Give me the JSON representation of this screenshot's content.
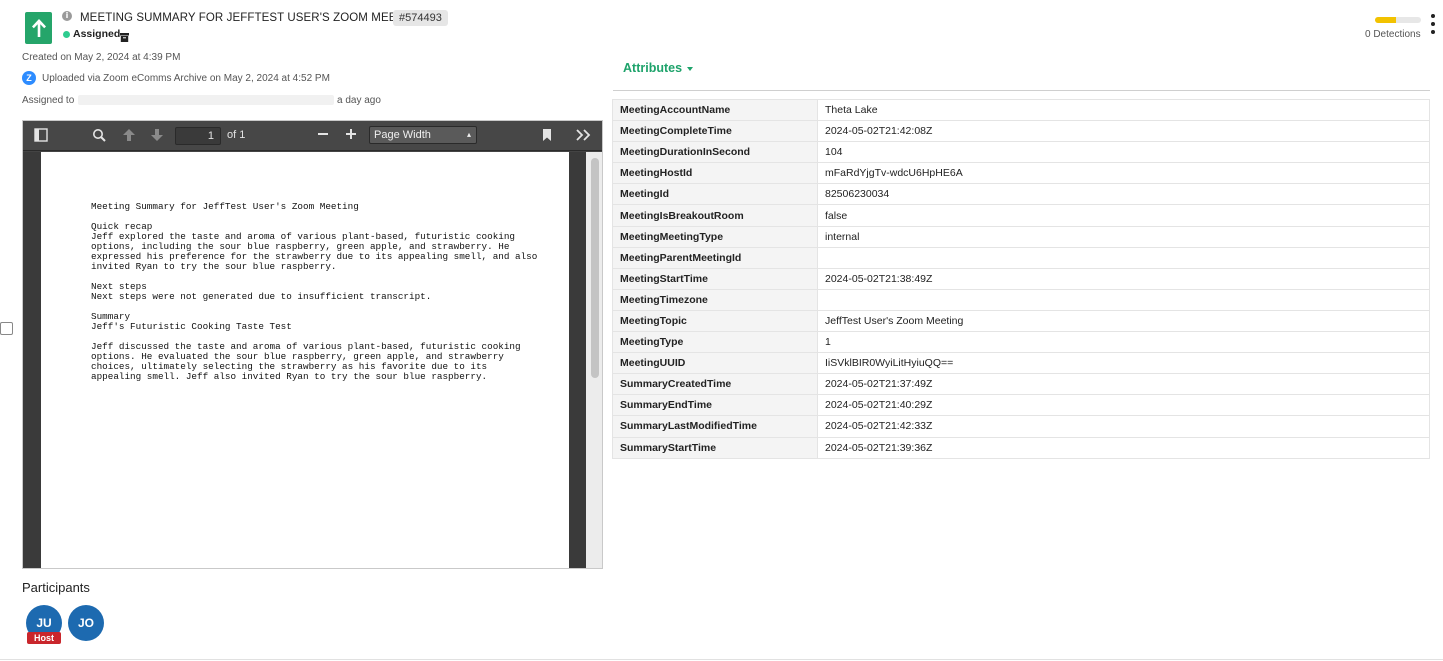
{
  "header": {
    "title": "MEETING SUMMARY FOR JEFFTEST USER'S ZOOM MEETING",
    "id": "#574493",
    "status": "Assigned",
    "accent_color": "#25a56a"
  },
  "meta": {
    "created": "Created on May 2, 2024 at 4:39 PM",
    "uploaded": "Uploaded via Zoom eComms Archive on May 2, 2024 at 4:52 PM",
    "assigned_prefix": "Assigned to",
    "assigned_suffix": "a day ago",
    "zoom_logo_letter": "Z"
  },
  "detections": {
    "label": "0 Detections",
    "level_fraction": 0.45
  },
  "viewer": {
    "page_number": "1",
    "page_of": "of 1",
    "zoom_value": "Page Width",
    "document_text": "Meeting Summary for JeffTest User's Zoom Meeting\n\nQuick recap\nJeff explored the taste and aroma of various plant-based, futuristic cooking\noptions, including the sour blue raspberry, green apple, and strawberry. He\nexpressed his preference for the strawberry due to its appealing smell, and also\ninvited Ryan to try the sour blue raspberry.\n\nNext steps\nNext steps were not generated due to insufficient transcript.\n\nSummary\nJeff's Futuristic Cooking Taste Test\n\nJeff discussed the taste and aroma of various plant-based, futuristic cooking\noptions. He evaluated the sour blue raspberry, green apple, and strawberry\nchoices, ultimately selecting the strawberry as his favorite due to its\nappealing smell. Jeff also invited Ryan to try the sour blue raspberry."
  },
  "participants": {
    "title": "Participants",
    "list": [
      {
        "initials": "JU",
        "badge": "Host"
      },
      {
        "initials": "JO",
        "badge": ""
      }
    ]
  },
  "attributes": {
    "title": "Attributes",
    "rows": [
      {
        "key": "MeetingAccountName",
        "value": "Theta Lake"
      },
      {
        "key": "MeetingCompleteTime",
        "value": "2024-05-02T21:42:08Z"
      },
      {
        "key": "MeetingDurationInSecond",
        "value": "104"
      },
      {
        "key": "MeetingHostId",
        "value": "mFaRdYjgTv-wdcU6HpHE6A"
      },
      {
        "key": "MeetingId",
        "value": "82506230034"
      },
      {
        "key": "MeetingIsBreakoutRoom",
        "value": "false"
      },
      {
        "key": "MeetingMeetingType",
        "value": "internal"
      },
      {
        "key": "MeetingParentMeetingId",
        "value": ""
      },
      {
        "key": "MeetingStartTime",
        "value": "2024-05-02T21:38:49Z"
      },
      {
        "key": "MeetingTimezone",
        "value": ""
      },
      {
        "key": "MeetingTopic",
        "value": "JeffTest User's Zoom Meeting"
      },
      {
        "key": "MeetingType",
        "value": "1"
      },
      {
        "key": "MeetingUUID",
        "value": "IiSVklBIR0WyiLitHyiuQQ=="
      },
      {
        "key": "SummaryCreatedTime",
        "value": "2024-05-02T21:37:49Z"
      },
      {
        "key": "SummaryEndTime",
        "value": "2024-05-02T21:40:29Z"
      },
      {
        "key": "SummaryLastModifiedTime",
        "value": "2024-05-02T21:42:33Z"
      },
      {
        "key": "SummaryStartTime",
        "value": "2024-05-02T21:39:36Z"
      }
    ]
  }
}
